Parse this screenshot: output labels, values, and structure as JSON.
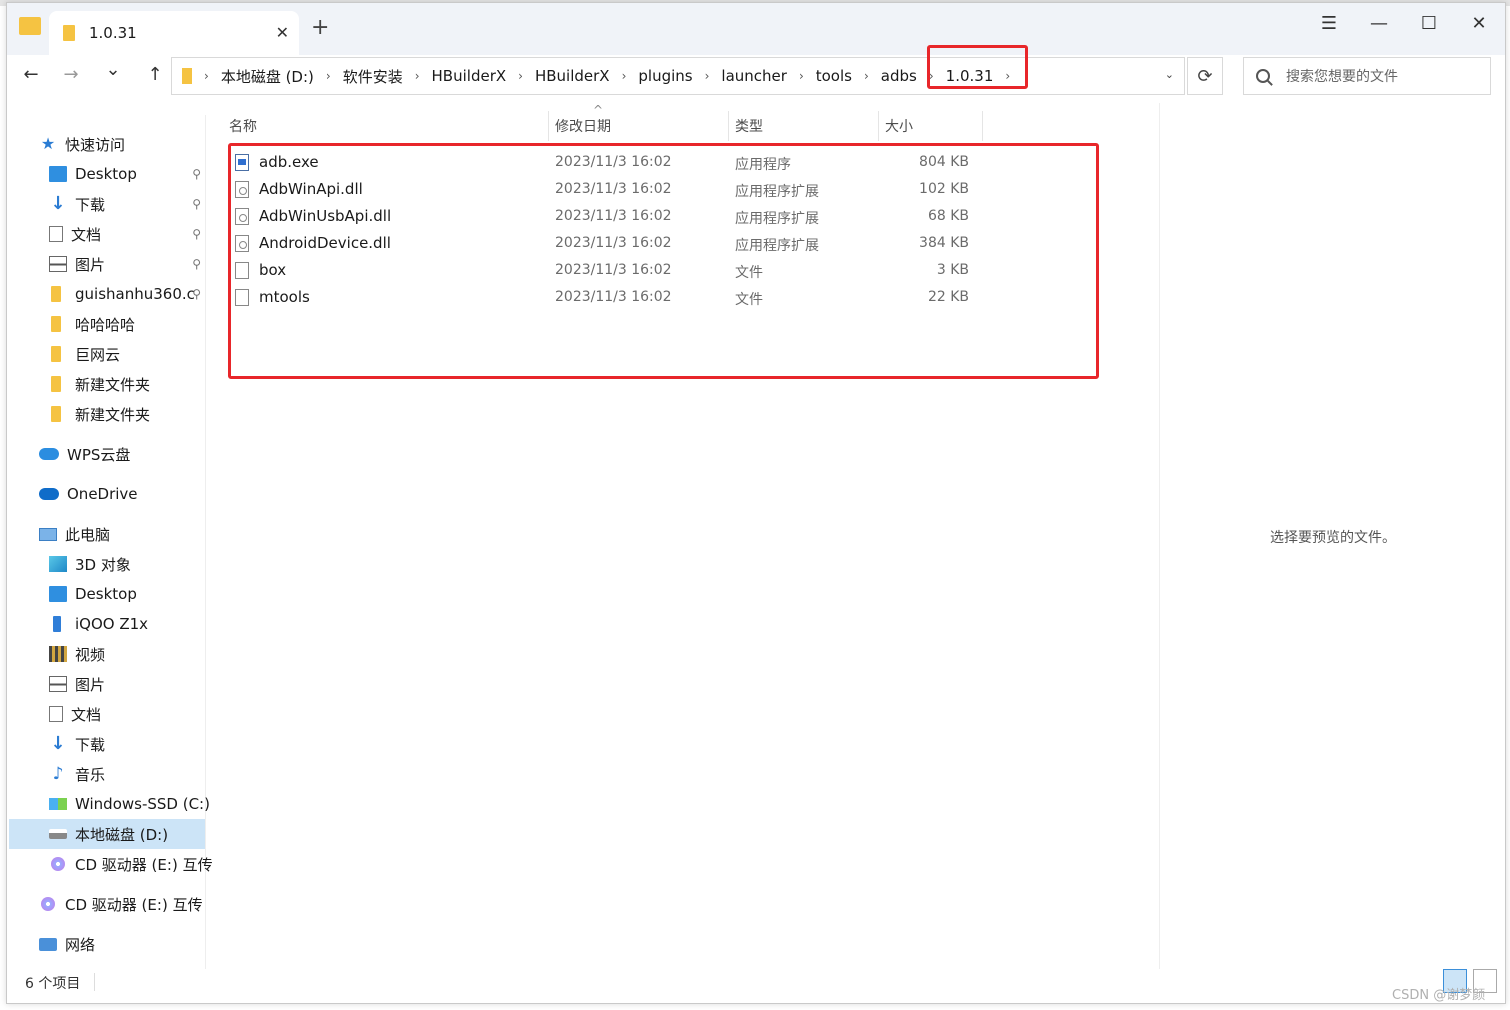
{
  "tab": {
    "title": "1.0.31",
    "close": "✕",
    "new": "+"
  },
  "window_controls": {
    "menu": "☰",
    "minimize": "—",
    "maximize": "☐",
    "close": "✕"
  },
  "nav": {
    "back": "←",
    "forward": "→",
    "recent": "⌄",
    "up": "↑",
    "refresh": "⟳",
    "dropdown": "⌄"
  },
  "breadcrumb": [
    "本地磁盘 (D:)",
    "软件安装",
    "HBuilderX",
    "HBuilderX",
    "plugins",
    "launcher",
    "tools",
    "adbs",
    "1.0.31"
  ],
  "search": {
    "placeholder": "搜索您想要的文件"
  },
  "sidebar": {
    "quick_access": "快速访问",
    "items": [
      {
        "label": "Desktop",
        "icon": "desktop-icon",
        "pinned": true
      },
      {
        "label": "下载",
        "icon": "download-icon",
        "pinned": true
      },
      {
        "label": "文档",
        "icon": "document-icon",
        "pinned": true
      },
      {
        "label": "图片",
        "icon": "picture-icon",
        "pinned": true
      },
      {
        "label": "guishanhu360.c",
        "icon": "folder-icon",
        "pinned": true
      },
      {
        "label": "哈哈哈哈",
        "icon": "folder-icon",
        "pinned": false
      },
      {
        "label": "巨网云",
        "icon": "folder-icon",
        "pinned": false
      },
      {
        "label": "新建文件夹",
        "icon": "folder-icon",
        "pinned": false
      },
      {
        "label": "新建文件夹",
        "icon": "folder-icon",
        "pinned": false
      }
    ],
    "wps": "WPS云盘",
    "onedrive": "OneDrive",
    "this_pc": "此电脑",
    "pc_items": [
      {
        "label": "3D 对象",
        "icon": "3d-objects-icon"
      },
      {
        "label": "Desktop",
        "icon": "desktop-icon"
      },
      {
        "label": "iQOO Z1x",
        "icon": "phone-icon"
      },
      {
        "label": "视频",
        "icon": "video-icon"
      },
      {
        "label": "图片",
        "icon": "picture-icon"
      },
      {
        "label": "文档",
        "icon": "document-icon"
      },
      {
        "label": "下载",
        "icon": "download-icon"
      },
      {
        "label": "音乐",
        "icon": "music-icon"
      },
      {
        "label": "Windows-SSD (C:)",
        "icon": "windows-drive-icon"
      },
      {
        "label": "本地磁盘 (D:)",
        "icon": "drive-icon",
        "selected": true
      },
      {
        "label": "CD 驱动器 (E:) 互传",
        "icon": "cd-drive-icon"
      }
    ],
    "cd_drive": "CD 驱动器 (E:) 互传",
    "network": "网络",
    "pin_glyph": "📌"
  },
  "columns": {
    "name": "名称",
    "date": "修改日期",
    "type": "类型",
    "size": "大小",
    "sort_glyph": "^"
  },
  "files": [
    {
      "name": "adb.exe",
      "date": "2023/11/3 16:02",
      "type": "应用程序",
      "size": "804 KB",
      "kind": "exe"
    },
    {
      "name": "AdbWinApi.dll",
      "date": "2023/11/3 16:02",
      "type": "应用程序扩展",
      "size": "102 KB",
      "kind": "dll"
    },
    {
      "name": "AdbWinUsbApi.dll",
      "date": "2023/11/3 16:02",
      "type": "应用程序扩展",
      "size": "68 KB",
      "kind": "dll"
    },
    {
      "name": "AndroidDevice.dll",
      "date": "2023/11/3 16:02",
      "type": "应用程序扩展",
      "size": "384 KB",
      "kind": "dll"
    },
    {
      "name": "box",
      "date": "2023/11/3 16:02",
      "type": "文件",
      "size": "3 KB",
      "kind": "file"
    },
    {
      "name": "mtools",
      "date": "2023/11/3 16:02",
      "type": "文件",
      "size": "22 KB",
      "kind": "file"
    }
  ],
  "preview": {
    "text": "选择要预览的文件。"
  },
  "status": {
    "count": "6 个项目"
  },
  "watermark": "CSDN @谢梦颜",
  "colors": {
    "highlight": "#e8262a",
    "selected": "#cce4f7",
    "folder": "#f5c342"
  }
}
